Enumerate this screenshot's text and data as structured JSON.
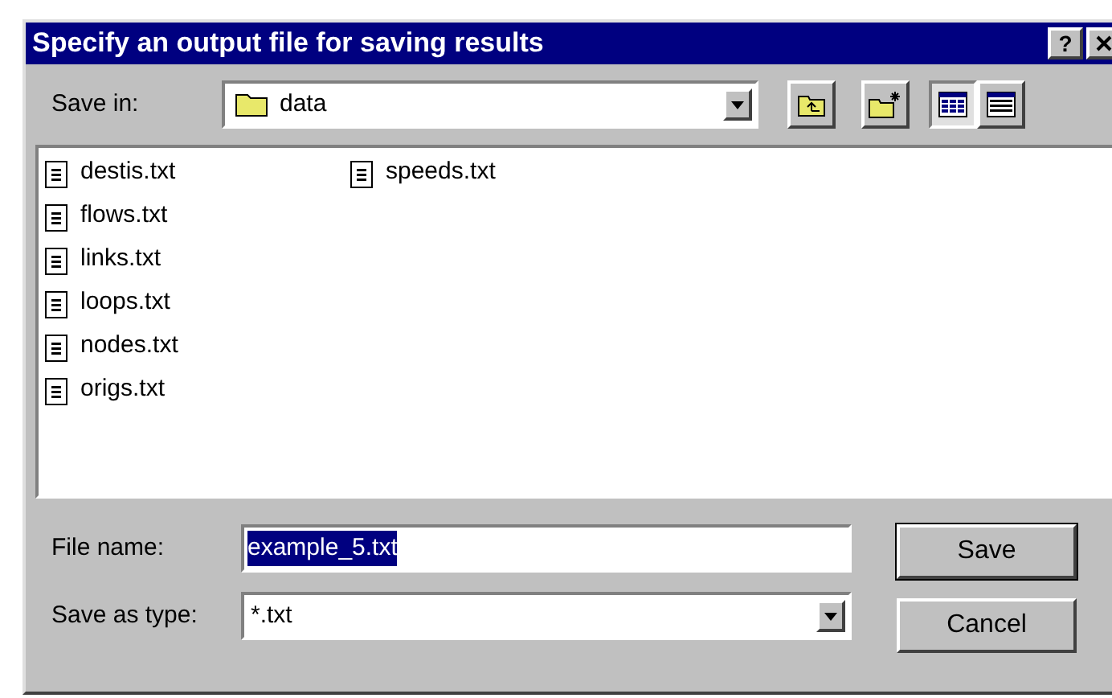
{
  "window": {
    "title": "Specify an output file for saving results",
    "help_button": "?"
  },
  "save_in": {
    "label": "Save in:",
    "value": "data"
  },
  "toolbar": [
    {
      "kind": "up"
    },
    {
      "kind": "new-folder"
    },
    {
      "kind": "list",
      "selected": true
    },
    {
      "kind": "details",
      "selected": false
    }
  ],
  "files": [
    {
      "name": "destis.txt",
      "selected": false
    },
    {
      "name": "flows.txt",
      "selected": false
    },
    {
      "name": "links.txt",
      "selected": false
    },
    {
      "name": "loops.txt",
      "selected": false
    },
    {
      "name": "nodes.txt",
      "selected": false
    },
    {
      "name": "origs.txt",
      "selected": false
    },
    {
      "name": "speeds.txt",
      "selected": false
    }
  ],
  "file_name": {
    "label": "File name:",
    "value": "example_5.txt"
  },
  "save_as_type": {
    "label": "Save as type:",
    "value": "*.txt"
  },
  "buttons": [
    {
      "label": "Save",
      "default": true
    },
    {
      "label": "Cancel",
      "default": false
    }
  ]
}
